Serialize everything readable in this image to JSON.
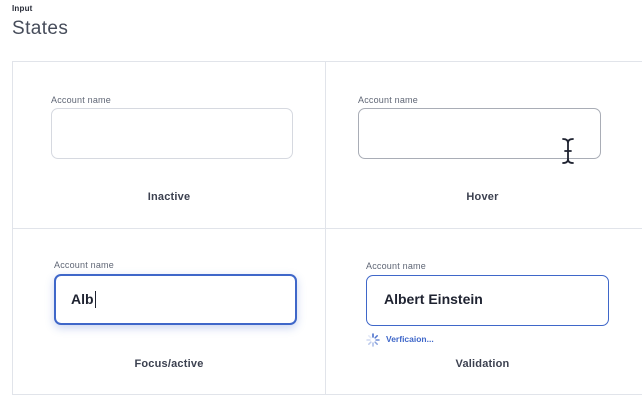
{
  "header": {
    "eyebrow": "Input",
    "title": "States"
  },
  "states": {
    "inactive": {
      "field_label": "Account name",
      "value": "",
      "caption": "Inactive"
    },
    "hover": {
      "field_label": "Account name",
      "value": "",
      "caption": "Hover",
      "cursor_icon": "text-cursor-icon"
    },
    "focus": {
      "field_label": "Account name",
      "value": "Alb",
      "caption": "Focus/active"
    },
    "validation": {
      "field_label": "Account name",
      "value": "Albert Einstein",
      "caption": "Validation",
      "status_text": "Verficaion...",
      "status_icon": "spinner-icon"
    }
  },
  "colors": {
    "accent": "#3f67c9",
    "border": "#d6d9e0",
    "hover_border": "#a9adb6",
    "grid_line": "#e1e4ea"
  }
}
